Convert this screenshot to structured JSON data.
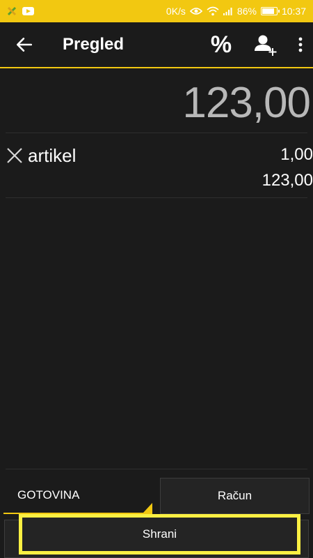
{
  "status_bar": {
    "network_speed": "0K/s",
    "battery_level": "86%",
    "battery_fraction": 0.86,
    "time": "10:37",
    "background_color": "#f2c811"
  },
  "app_bar": {
    "title": "Pregled",
    "back_icon": "arrow-left-icon",
    "discount_label": "%",
    "add_customer_icon": "add-person-icon",
    "menu_icon": "more-vertical-icon"
  },
  "total": "123,00",
  "items": [
    {
      "name": "artikel",
      "quantity": "1,00",
      "price": "123,00",
      "remove_icon": "close-icon"
    }
  ],
  "payment": {
    "method_label": "GOTOVINA",
    "invoice_button": "Račun",
    "save_button": "Shrani"
  },
  "colors": {
    "accent": "#f2c811",
    "highlight": "#fbf043",
    "background": "#1b1b1b",
    "total_text": "#b8b8b8"
  }
}
